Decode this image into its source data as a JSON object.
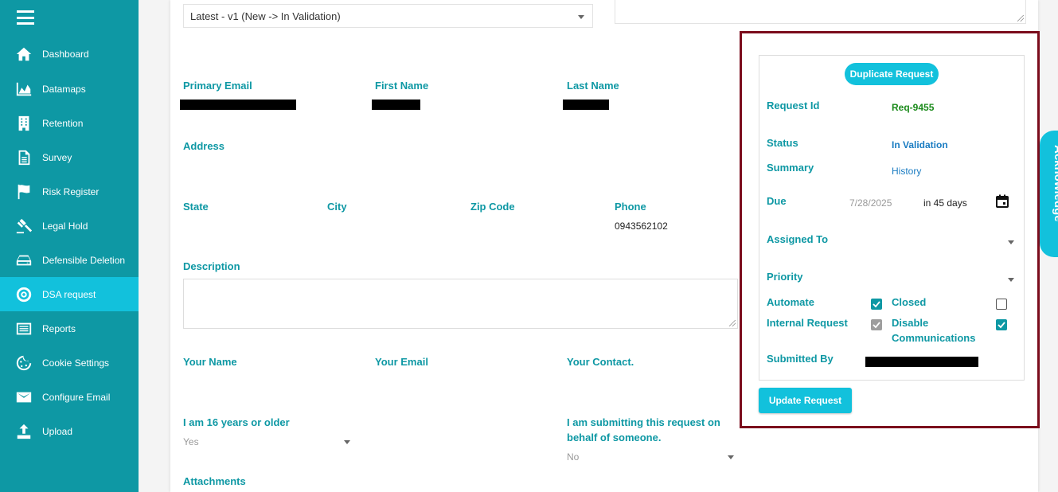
{
  "sidebar": {
    "items": [
      {
        "label": "Dashboard",
        "icon": "home-icon"
      },
      {
        "label": "Datamaps",
        "icon": "area-chart-icon"
      },
      {
        "label": "Retention",
        "icon": "building-icon"
      },
      {
        "label": "Survey",
        "icon": "document-icon"
      },
      {
        "label": "Risk Register",
        "icon": "flag-icon"
      },
      {
        "label": "Legal Hold",
        "icon": "gavel-icon"
      },
      {
        "label": "Defensible Deletion",
        "icon": "drive-icon"
      },
      {
        "label": "DSA request",
        "icon": "lifebuoy-icon"
      },
      {
        "label": "Reports",
        "icon": "list-icon"
      },
      {
        "label": "Cookie Settings",
        "icon": "cookie-icon"
      },
      {
        "label": "Configure Email",
        "icon": "envelope-icon"
      },
      {
        "label": "Upload",
        "icon": "upload-icon"
      }
    ],
    "active": "DSA request"
  },
  "form": {
    "version": "Latest - v1 (New -> In Validation)",
    "primary_email_label": "Primary Email",
    "first_name_label": "First Name",
    "last_name_label": "Last Name",
    "address_label": "Address",
    "state_label": "State",
    "city_label": "City",
    "zip_label": "Zip Code",
    "phone_label": "Phone",
    "phone_value": "0943562102",
    "description_label": "Description",
    "your_name_label": "Your Name",
    "your_email_label": "Your Email",
    "your_contact_label": "Your Contact.",
    "age_label": "I am 16 years or older",
    "age_value": "Yes",
    "behalf_label_line1": "I am submitting this request on",
    "behalf_label_line2": "behalf of someone.",
    "behalf_value": "No",
    "attachments_label": "Attachments"
  },
  "panel": {
    "duplicate_button": "Duplicate Request",
    "request_id_label": "Request Id",
    "request_id": "Req-9455",
    "status_label": "Status",
    "status": "In Validation",
    "summary_label": "Summary",
    "summary_link": "History",
    "due_label": "Due",
    "due_date": "7/28/2025",
    "due_relative": "in 45 days",
    "assigned_label": "Assigned To",
    "priority_label": "Priority",
    "automate_label": "Automate",
    "automate_checked": true,
    "closed_label": "Closed",
    "closed_checked": false,
    "internal_label": "Internal Request",
    "internal_checked": true,
    "disable_label_line1": "Disable",
    "disable_label_line2": "Communications",
    "disable_checked": true,
    "submitted_label": "Submitted By",
    "update_button": "Update Request"
  },
  "ack_tab": "Acknowledge",
  "colors": {
    "sidebar": "#0e98a4",
    "sidebar_active": "#12c1dc",
    "label": "#0e98a4",
    "highlight_border": "#7b0c1c",
    "request_id": "#1c8b1c",
    "status": "#1a7cc2"
  }
}
